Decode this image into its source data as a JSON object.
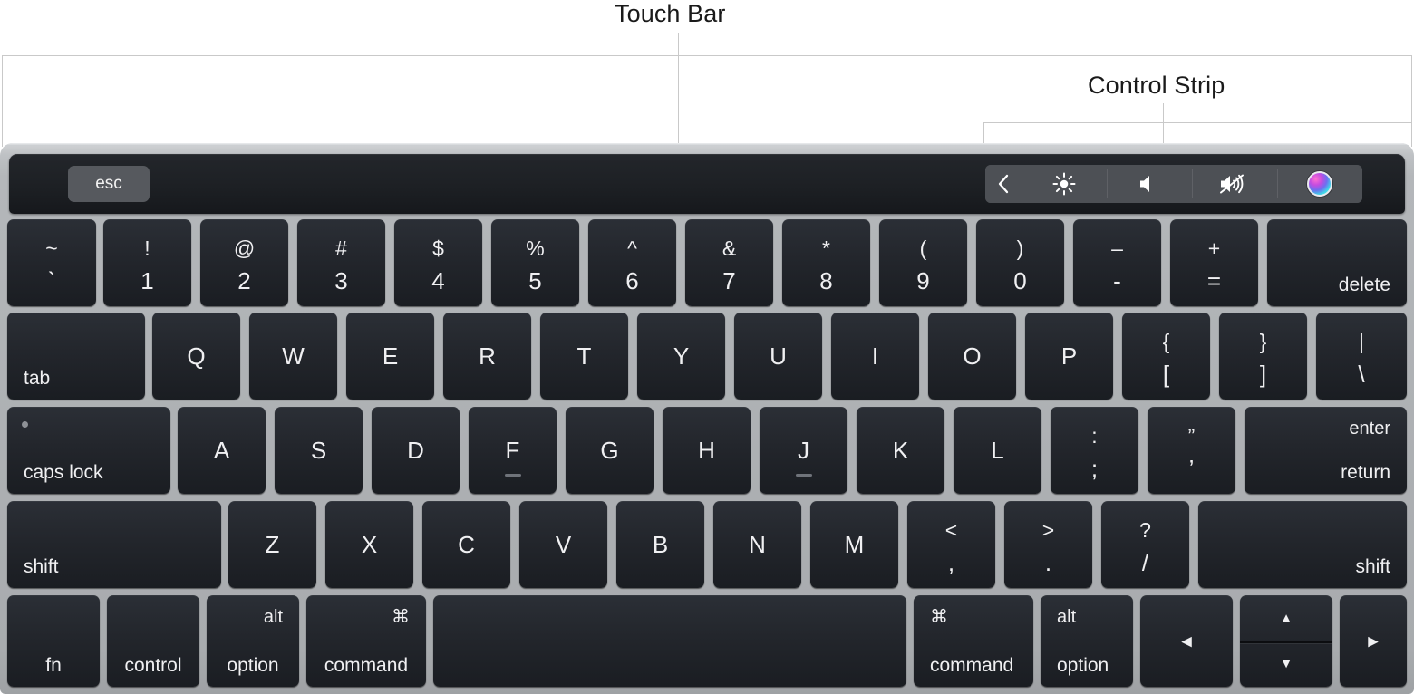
{
  "callouts": {
    "touch_bar": "Touch Bar",
    "control_strip": "Control Strip"
  },
  "touch_bar": {
    "esc_label": "esc",
    "control_strip_buttons": [
      {
        "icon": "chevron-left-icon",
        "glyph": "❮",
        "name": "expand-control-strip"
      },
      {
        "icon": "brightness-icon",
        "glyph": "☀",
        "name": "brightness-up"
      },
      {
        "icon": "volume-icon",
        "glyph": "◀",
        "name": "volume-up"
      },
      {
        "icon": "mute-icon",
        "glyph": "◀",
        "name": "mute"
      },
      {
        "icon": "siri-icon",
        "glyph": "",
        "name": "siri"
      }
    ]
  },
  "rows": {
    "number_row": [
      {
        "upper": "~",
        "lower": "`"
      },
      {
        "upper": "!",
        "lower": "1"
      },
      {
        "upper": "@",
        "lower": "2"
      },
      {
        "upper": "#",
        "lower": "3"
      },
      {
        "upper": "$",
        "lower": "4"
      },
      {
        "upper": "%",
        "lower": "5"
      },
      {
        "upper": "^",
        "lower": "6"
      },
      {
        "upper": "&",
        "lower": "7"
      },
      {
        "upper": "*",
        "lower": "8"
      },
      {
        "upper": "(",
        "lower": "9"
      },
      {
        "upper": ")",
        "lower": "0"
      },
      {
        "upper": "–",
        "lower": "-"
      },
      {
        "upper": "+",
        "lower": "="
      },
      {
        "word": "delete"
      }
    ],
    "tab_row": [
      {
        "word": "tab"
      },
      {
        "letter": "Q"
      },
      {
        "letter": "W"
      },
      {
        "letter": "E"
      },
      {
        "letter": "R"
      },
      {
        "letter": "T"
      },
      {
        "letter": "Y"
      },
      {
        "letter": "U"
      },
      {
        "letter": "I"
      },
      {
        "letter": "O"
      },
      {
        "letter": "P"
      },
      {
        "upper": "{",
        "lower": "["
      },
      {
        "upper": "}",
        "lower": "]"
      },
      {
        "upper": "|",
        "lower": "\\"
      }
    ],
    "caps_row": [
      {
        "word": "caps lock"
      },
      {
        "letter": "A"
      },
      {
        "letter": "S"
      },
      {
        "letter": "D"
      },
      {
        "letter": "F"
      },
      {
        "letter": "G"
      },
      {
        "letter": "H"
      },
      {
        "letter": "J"
      },
      {
        "letter": "K"
      },
      {
        "letter": "L"
      },
      {
        "upper": ":",
        "lower": ";"
      },
      {
        "upper": "”",
        "lower": "’"
      },
      {
        "word_top": "enter",
        "word_bottom": "return"
      }
    ],
    "shift_row": [
      {
        "word": "shift"
      },
      {
        "letter": "Z"
      },
      {
        "letter": "X"
      },
      {
        "letter": "C"
      },
      {
        "letter": "V"
      },
      {
        "letter": "B"
      },
      {
        "letter": "N"
      },
      {
        "letter": "M"
      },
      {
        "upper": "<",
        "lower": ","
      },
      {
        "upper": ">",
        "lower": "."
      },
      {
        "upper": "?",
        "lower": "/"
      },
      {
        "word": "shift"
      }
    ],
    "bottom_row": [
      {
        "word": "fn"
      },
      {
        "word": "control"
      },
      {
        "word_top": "alt",
        "word_bottom": "option"
      },
      {
        "word_top": "⌘",
        "word_bottom": "command"
      },
      {
        "word": ""
      },
      {
        "word_top": "⌘",
        "word_bottom": "command"
      },
      {
        "word_top": "alt",
        "word_bottom": "option"
      },
      {
        "glyph": "◀",
        "name": "arrow-left"
      },
      {
        "glyph_up": "▲",
        "glyph_down": "▼",
        "name": "arrow-up-down"
      },
      {
        "glyph": "▶",
        "name": "arrow-right"
      }
    ]
  },
  "colors": {
    "chassis": "#b0b3b6",
    "key": "#23262c",
    "key_text": "#f0f0f2",
    "touchbar": "#1d2024",
    "control_strip_btn": "#4d5055",
    "esc_btn": "#56595e",
    "callout_line": "#c9c9c9",
    "label_text": "#1a1a1a"
  }
}
